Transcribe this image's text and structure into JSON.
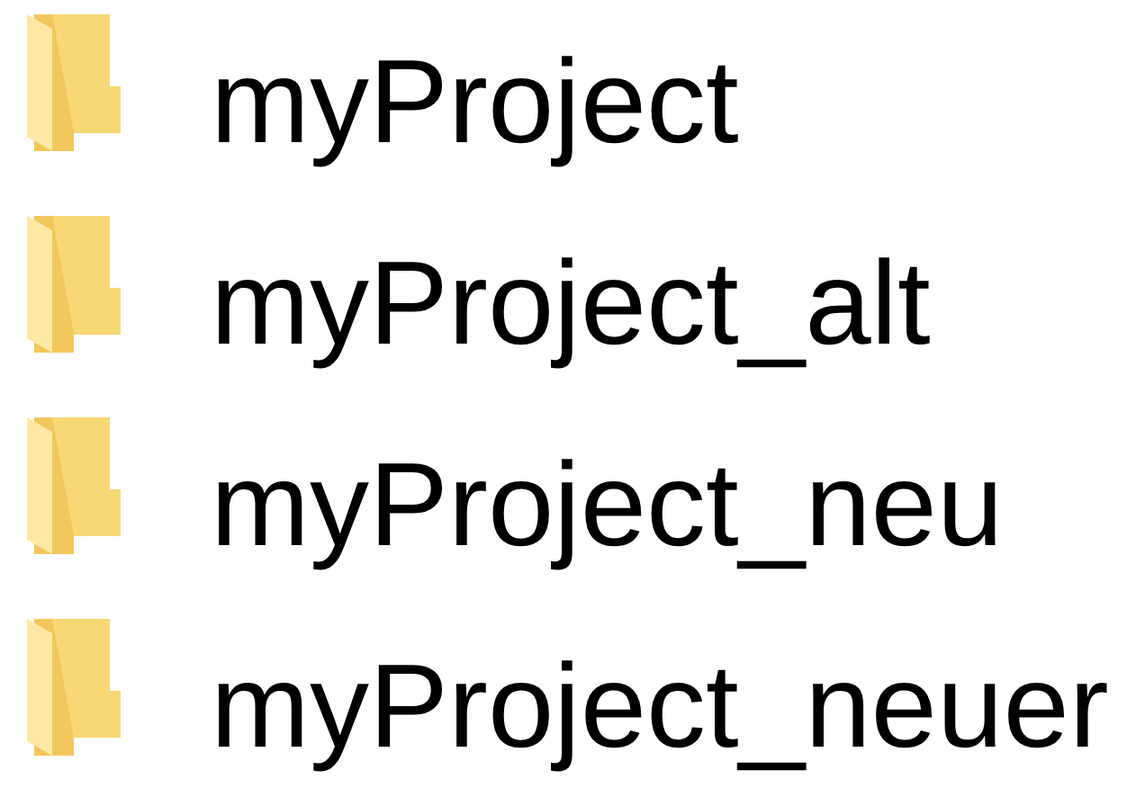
{
  "items": [
    {
      "name": "myProject"
    },
    {
      "name": "myProject_alt"
    },
    {
      "name": "myProject_neu"
    },
    {
      "name": "myProject_neuer"
    }
  ]
}
